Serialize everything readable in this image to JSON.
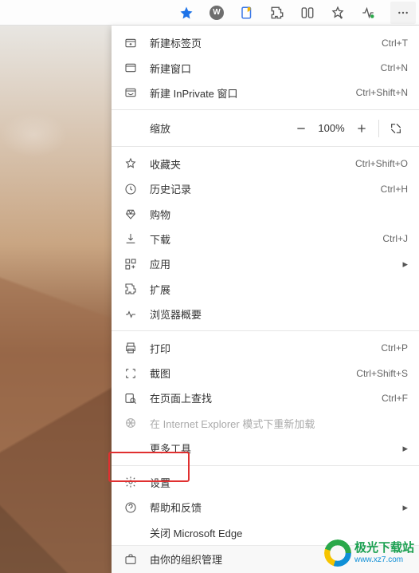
{
  "toolbar": {
    "icons": [
      "star-icon",
      "wallet-icon",
      "collections-icon",
      "extensions-icon",
      "split-icon",
      "favorites-icon",
      "performance-icon",
      "more-icon"
    ]
  },
  "menu": {
    "new_tab": {
      "label": "新建标签页",
      "shortcut": "Ctrl+T"
    },
    "new_window": {
      "label": "新建窗口",
      "shortcut": "Ctrl+N"
    },
    "new_inprivate": {
      "label": "新建 InPrivate 窗口",
      "shortcut": "Ctrl+Shift+N"
    },
    "zoom": {
      "label": "缩放",
      "value": "100%"
    },
    "favorites": {
      "label": "收藏夹",
      "shortcut": "Ctrl+Shift+O"
    },
    "history": {
      "label": "历史记录",
      "shortcut": "Ctrl+H"
    },
    "shopping": {
      "label": "购物"
    },
    "downloads": {
      "label": "下载",
      "shortcut": "Ctrl+J"
    },
    "apps": {
      "label": "应用"
    },
    "extensions": {
      "label": "扩展"
    },
    "browser_essentials": {
      "label": "浏览器概要"
    },
    "print": {
      "label": "打印",
      "shortcut": "Ctrl+P"
    },
    "screenshot": {
      "label": "截图",
      "shortcut": "Ctrl+Shift+S"
    },
    "find": {
      "label": "在页面上查找",
      "shortcut": "Ctrl+F"
    },
    "ie_mode": {
      "label": "在 Internet Explorer 模式下重新加载"
    },
    "more_tools": {
      "label": "更多工具"
    },
    "settings": {
      "label": "设置"
    },
    "help": {
      "label": "帮助和反馈"
    },
    "close_edge": {
      "label": "关闭 Microsoft Edge"
    },
    "managed": {
      "label": "由你的组织管理"
    }
  },
  "watermark": {
    "name": "极光下载站",
    "url": "www.xz7.com"
  }
}
